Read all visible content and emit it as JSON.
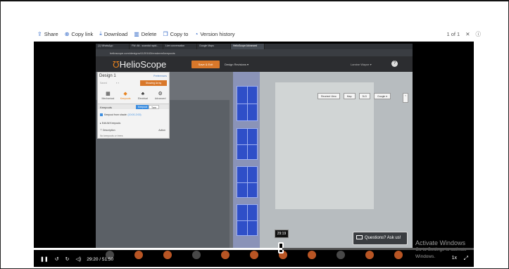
{
  "toolbar": {
    "items": [
      {
        "label": "Share",
        "icon": "share-icon"
      },
      {
        "label": "Copy link",
        "icon": "link-icon"
      },
      {
        "label": "Download",
        "icon": "download-icon"
      },
      {
        "label": "Delete",
        "icon": "trash-icon"
      },
      {
        "label": "Copy to",
        "icon": "copy-icon"
      },
      {
        "label": "Version history",
        "icon": "history-icon"
      }
    ],
    "page_count": "1 of 1",
    "close_glyph": "✕"
  },
  "browser": {
    "tabs": [
      "(1) WhatsApp",
      "FW: Att - scandal rapid...",
      "Live conversation",
      "Google Maps",
      "HelioScope Advanced",
      ""
    ],
    "address": "helioscope.com/designs/1120163/renderer/keepouts",
    "tooltip": "Presenting"
  },
  "app": {
    "logo": "HelioScope",
    "save_button": "Save & Exit",
    "design_revisions": "Design Revisions ▾",
    "user": "Lamine Wayne ▾",
    "panel": {
      "title": "Design 1",
      "preferences": "Preferences",
      "saved": "Saved",
      "show_array": "Showing Array",
      "tools": [
        {
          "label": "Mechanical",
          "glyph": "▦",
          "active": false
        },
        {
          "label": "Keepouts",
          "glyph": "◆",
          "active": true
        },
        {
          "label": "Electrical",
          "glyph": "♣",
          "active": false
        },
        {
          "label": "Advanced",
          "glyph": "⚙",
          "active": false
        }
      ],
      "keepouts_title": "Keepouts",
      "tab_keepout": "Keepout",
      "tab_tree": "Tree",
      "from_shade": "Keepout from shade:",
      "from_shade_value": "(10:00-2:00)",
      "edit_all": "Edit All Keepouts",
      "col_description": "Description",
      "col_action": "Action",
      "empty": "No keepouts or trees"
    },
    "map_buttons": [
      "Reorient View",
      "Map",
      "3LD",
      "Google ▾"
    ],
    "questions": "Questions? Ask us!"
  },
  "watermark": {
    "line1": "Activate Windows",
    "line2": "Go to Settings to activate Windows."
  },
  "player": {
    "tooltip_time": "29:19",
    "current_time": "29:20 / 51:50",
    "progress": 0.565,
    "speed": "1x"
  }
}
